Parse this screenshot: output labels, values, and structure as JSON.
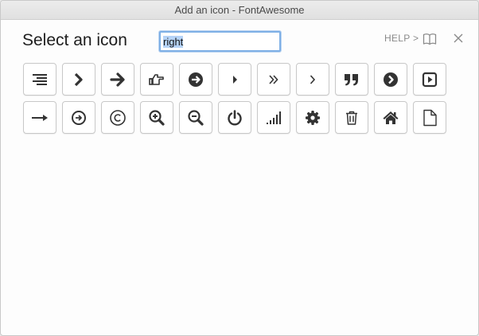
{
  "window": {
    "title": "Add an icon - FontAwesome"
  },
  "header": {
    "title": "Select an icon",
    "search_value": "right",
    "help_label": "HELP >"
  },
  "icons": [
    [
      "align-right-icon",
      "chevron-right-icon",
      "arrow-right-icon",
      "hand-o-right-icon",
      "arrow-circle-right-icon",
      "caret-right-icon",
      "angle-double-right-icon",
      "angle-right-icon",
      "quote-right-icon",
      "chevron-circle-right-icon",
      "caret-square-o-right-icon"
    ],
    [
      "long-arrow-right-icon",
      "arrow-circle-o-right-icon",
      "copyright-icon",
      "search-plus-icon",
      "search-minus-icon",
      "power-off-icon",
      "signal-icon",
      "cog-icon",
      "trash-o-icon",
      "home-icon",
      "file-o-icon"
    ]
  ],
  "colors": {
    "icon": "#333333",
    "focus": "#7fb0e6",
    "selection": "#b5d3f7"
  }
}
